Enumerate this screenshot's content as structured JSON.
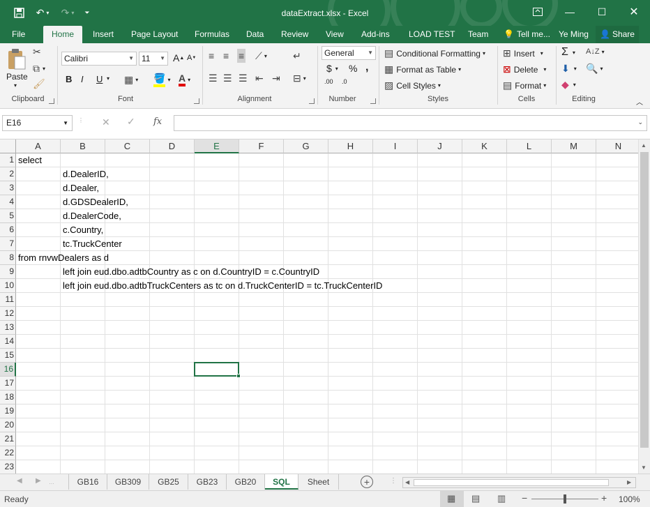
{
  "title": "dataExtract.xlsx - Excel",
  "quick_access": {
    "save_icon": "save-icon",
    "undo_icon": "undo-icon",
    "redo_icon": "redo-icon",
    "customize_icon": "customize-icon"
  },
  "window": {
    "ribbon_display_icon": "ribbon-display-icon",
    "minimize_icon": "minimize-icon",
    "maximize_icon": "maximize-icon",
    "close_icon": "close-icon"
  },
  "tabs": [
    "File",
    "Home",
    "Insert",
    "Page Layout",
    "Formulas",
    "Data",
    "Review",
    "View",
    "Add-ins",
    "LOAD TEST",
    "Team"
  ],
  "tell_me": "Tell me...",
  "user": "Ye Ming",
  "share": "Share",
  "ribbon": {
    "clipboard": {
      "label": "Clipboard",
      "paste": "Paste"
    },
    "font": {
      "label": "Font",
      "name": "Calibri",
      "size": "11",
      "bold": "B",
      "italic": "I",
      "underline": "U",
      "grow": "A",
      "shrink": "A"
    },
    "alignment": {
      "label": "Alignment"
    },
    "number": {
      "label": "Number",
      "format": "General",
      "currency": "$",
      "percent": "%",
      "comma": ",",
      "inc_decimal": ".00",
      "dec_decimal": ".0"
    },
    "styles": {
      "label": "Styles",
      "conditional": "Conditional Formatting",
      "format_table": "Format as Table",
      "cell_styles": "Cell Styles"
    },
    "cells": {
      "label": "Cells",
      "insert": "Insert",
      "delete": "Delete",
      "format": "Format"
    },
    "editing": {
      "label": "Editing"
    }
  },
  "name_box": "E16",
  "formula_value": "",
  "fx": "fx",
  "columns": [
    "A",
    "B",
    "C",
    "D",
    "E",
    "F",
    "G",
    "H",
    "I",
    "J",
    "K",
    "L",
    "M",
    "N"
  ],
  "selected_column": "E",
  "rows": [
    "1",
    "2",
    "3",
    "4",
    "5",
    "6",
    "7",
    "8",
    "9",
    "10",
    "11",
    "12",
    "13",
    "14",
    "15",
    "16",
    "17",
    "18",
    "19",
    "20",
    "21",
    "22",
    "23"
  ],
  "selected_row": "16",
  "cells": [
    {
      "col": "A",
      "row": 1,
      "text": "select"
    },
    {
      "col": "B",
      "row": 2,
      "text": "d.DealerID,"
    },
    {
      "col": "B",
      "row": 3,
      "text": "d.Dealer,"
    },
    {
      "col": "B",
      "row": 4,
      "text": "d.GDSDealerID,"
    },
    {
      "col": "B",
      "row": 5,
      "text": "d.DealerCode,"
    },
    {
      "col": "B",
      "row": 6,
      "text": "c.Country,"
    },
    {
      "col": "B",
      "row": 7,
      "text": "tc.TruckCenter"
    },
    {
      "col": "A",
      "row": 8,
      "text": "from rnvwDealers as d"
    },
    {
      "col": "B",
      "row": 9,
      "text": "left join eud.dbo.adtbCountry as c on d.CountryID = c.CountryID"
    },
    {
      "col": "B",
      "row": 10,
      "text": "left join eud.dbo.adtbTruckCenters as tc on d.TruckCenterID = tc.TruckCenterID"
    }
  ],
  "sheets": [
    "GB16",
    "GB309",
    "GB25",
    "GB23",
    "GB20",
    "SQL",
    "Sheet"
  ],
  "active_sheet": "SQL",
  "status": {
    "ready": "Ready",
    "zoom": "100%",
    "zoom_level": 1.0
  }
}
